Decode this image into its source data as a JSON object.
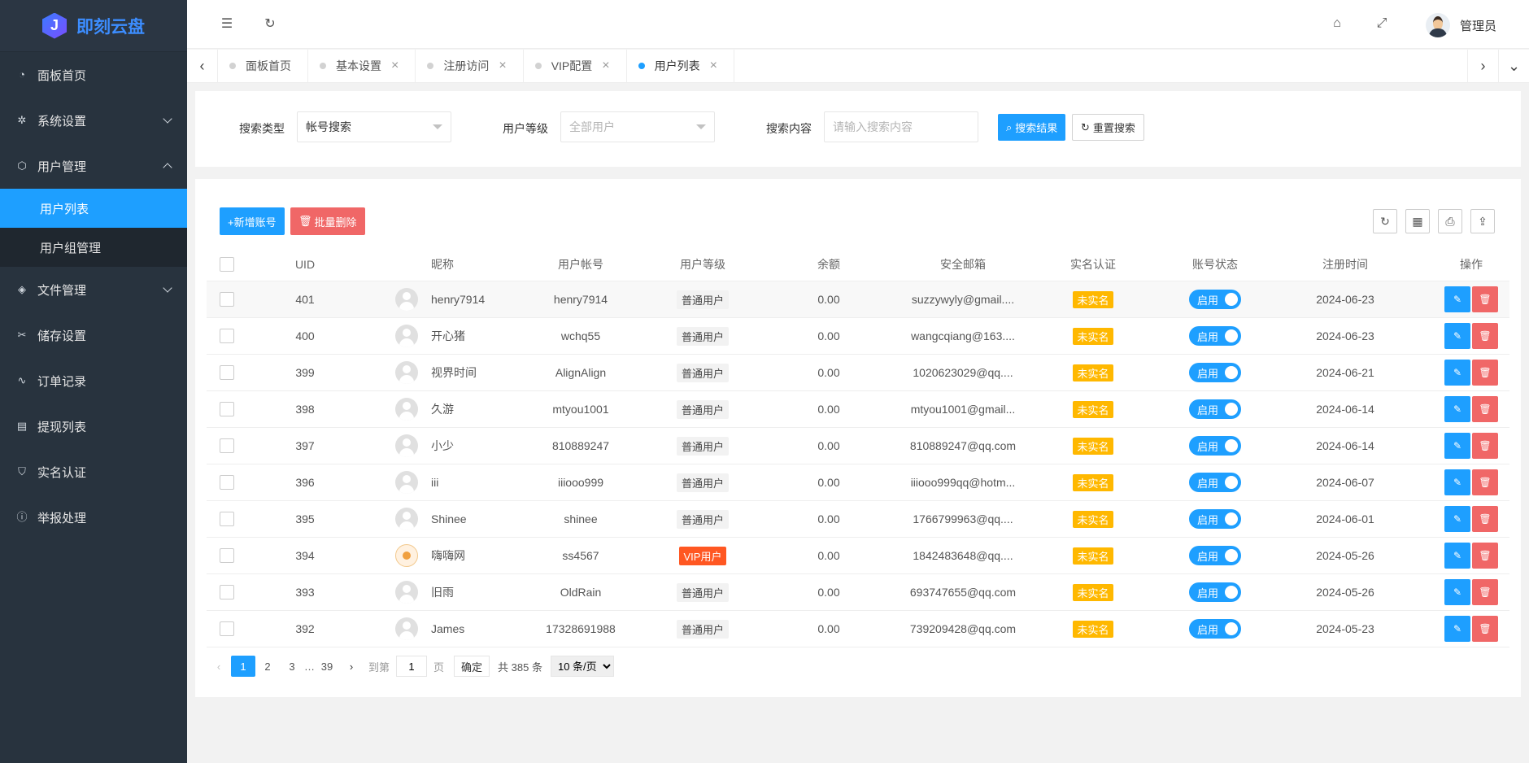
{
  "brand": {
    "logo_letter": "J",
    "name": "即刻云盘"
  },
  "sidebar": {
    "items": [
      {
        "label": "面板首页",
        "icon": "speedometer-icon"
      },
      {
        "label": "系统设置",
        "icon": "gear-icon"
      },
      {
        "label": "用户管理",
        "icon": "cube-icon"
      },
      {
        "label": "文件管理",
        "icon": "layers-icon"
      },
      {
        "label": "储存设置",
        "icon": "tools-icon"
      },
      {
        "label": "订单记录",
        "icon": "pulse-icon"
      },
      {
        "label": "提现列表",
        "icon": "receipt-icon"
      },
      {
        "label": "实名认证",
        "icon": "shield-check-icon"
      },
      {
        "label": "举报处理",
        "icon": "info-circle-icon"
      }
    ],
    "sub_items": [
      {
        "label": "用户列表"
      },
      {
        "label": "用户组管理"
      }
    ]
  },
  "header": {
    "admin_name": "管理员"
  },
  "tabs": [
    {
      "label": "面板首页"
    },
    {
      "label": "基本设置"
    },
    {
      "label": "注册访问"
    },
    {
      "label": "VIP配置"
    },
    {
      "label": "用户列表"
    }
  ],
  "search": {
    "type_label": "搜索类型",
    "type_value": "帐号搜索",
    "level_label": "用户等级",
    "level_placeholder": "全部用户",
    "content_label": "搜索内容",
    "content_placeholder": "请输入搜索内容",
    "search_btn": "搜索结果",
    "reset_btn": "重置搜索"
  },
  "actions": {
    "add": "+新增账号",
    "batch_delete": "批量删除"
  },
  "columns": [
    "UID",
    "昵称",
    "用户帐号",
    "用户等级",
    "余额",
    "安全邮箱",
    "实名认证",
    "账号状态",
    "注册时间",
    "操作"
  ],
  "rows": [
    {
      "uid": "401",
      "nick": "henry7914",
      "account": "henry7914",
      "level": "普通用户",
      "balance": "0.00",
      "email": "suzzywyly@gmail....",
      "realname": "未实名",
      "status": "启用",
      "date": "2024-06-23"
    },
    {
      "uid": "400",
      "nick": "开心猪",
      "account": "wchq55",
      "level": "普通用户",
      "balance": "0.00",
      "email": "wangcqiang@163....",
      "realname": "未实名",
      "status": "启用",
      "date": "2024-06-23"
    },
    {
      "uid": "399",
      "nick": "视界时间",
      "account": "AlignAlign",
      "level": "普通用户",
      "balance": "0.00",
      "email": "1020623029@qq....",
      "realname": "未实名",
      "status": "启用",
      "date": "2024-06-21"
    },
    {
      "uid": "398",
      "nick": "久游",
      "account": "mtyou1001",
      "level": "普通用户",
      "balance": "0.00",
      "email": "mtyou1001@gmail...",
      "realname": "未实名",
      "status": "启用",
      "date": "2024-06-14"
    },
    {
      "uid": "397",
      "nick": "小少",
      "account": "810889247",
      "level": "普通用户",
      "balance": "0.00",
      "email": "810889247@qq.com",
      "realname": "未实名",
      "status": "启用",
      "date": "2024-06-14"
    },
    {
      "uid": "396",
      "nick": "iii",
      "account": "iiiooo999",
      "level": "普通用户",
      "balance": "0.00",
      "email": "iiiooo999qq@hotm...",
      "realname": "未实名",
      "status": "启用",
      "date": "2024-06-07"
    },
    {
      "uid": "395",
      "nick": "Shinee",
      "account": "shinee",
      "level": "普通用户",
      "balance": "0.00",
      "email": "1766799963@qq....",
      "realname": "未实名",
      "status": "启用",
      "date": "2024-06-01"
    },
    {
      "uid": "394",
      "nick": "嗨嗨网",
      "account": "ss4567",
      "level": "VIP用户",
      "balance": "0.00",
      "email": "1842483648@qq....",
      "realname": "未实名",
      "status": "启用",
      "date": "2024-05-26"
    },
    {
      "uid": "393",
      "nick": "旧雨",
      "account": "OldRain",
      "level": "普通用户",
      "balance": "0.00",
      "email": "693747655@qq.com",
      "realname": "未实名",
      "status": "启用",
      "date": "2024-05-26"
    },
    {
      "uid": "392",
      "nick": "James",
      "account": "17328691988",
      "level": "普通用户",
      "balance": "0.00",
      "email": "739209428@qq.com",
      "realname": "未实名",
      "status": "启用",
      "date": "2024-05-23"
    }
  ],
  "pager": {
    "pages": [
      "1",
      "2",
      "3"
    ],
    "ellipsis": "…",
    "last": "39",
    "goto": "到第",
    "page_value": "1",
    "page_unit": "页",
    "ok": "确定",
    "total": "共 385 条",
    "size": "10 条/页"
  },
  "colors": {
    "primary": "#1e9fff",
    "danger": "#f06767",
    "warn": "#ffb800",
    "vip": "#ff5722",
    "sidebar": "#28333e"
  }
}
